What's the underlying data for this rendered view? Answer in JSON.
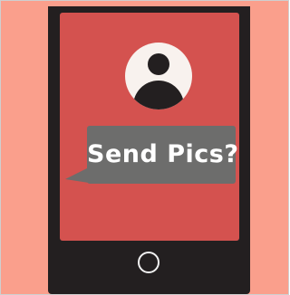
{
  "illustration": {
    "bubble_text": "Send Pics?",
    "avatar_icon": "user-avatar-icon",
    "home_icon": "home-button-icon"
  },
  "colors": {
    "background": "#fa9f8c",
    "phone_body": "#231f20",
    "screen": "#d4524f",
    "bubble": "#6d6d6c",
    "avatar_bg": "#f8f2ee",
    "text": "#ffffff"
  }
}
